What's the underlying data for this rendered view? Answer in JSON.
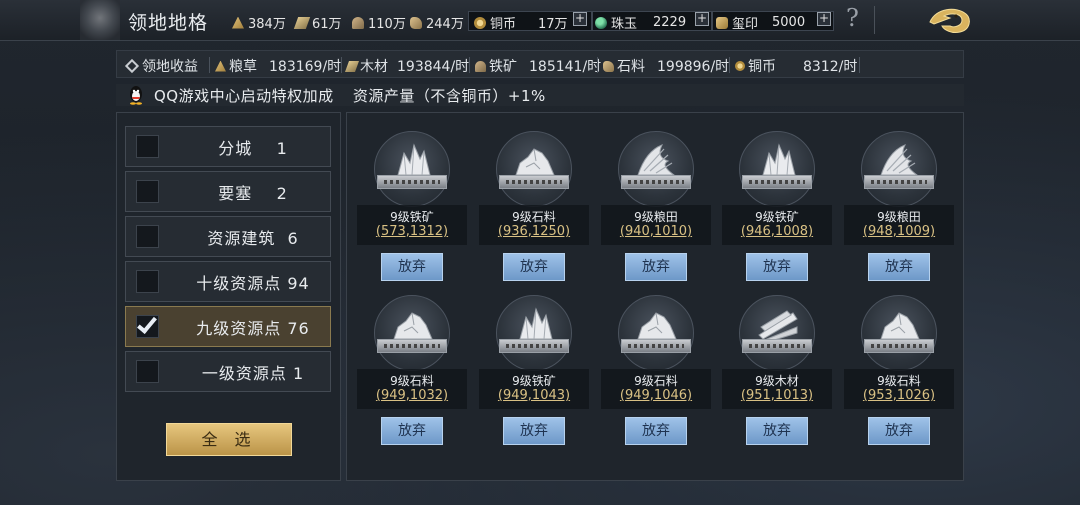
{
  "header": {
    "title": "领地地格",
    "resources": [
      {
        "icon": "grain-icon",
        "value": "384万"
      },
      {
        "icon": "wood-icon",
        "value": "61万"
      },
      {
        "icon": "iron-icon",
        "value": "110万"
      },
      {
        "icon": "stone-icon",
        "value": "244万"
      }
    ],
    "currencies": [
      {
        "icon": "copper-coin-icon",
        "label": "铜币",
        "value": "17万"
      },
      {
        "icon": "jade-icon",
        "label": "珠玉",
        "value": "2229"
      },
      {
        "icon": "seal-icon",
        "label": "玺印",
        "value": "5000"
      }
    ],
    "plus": "+",
    "help": "?"
  },
  "income": {
    "title": "领地收益",
    "items": [
      {
        "icon": "grain-icon",
        "label": "粮草",
        "value": "183169/时"
      },
      {
        "icon": "wood-icon",
        "label": "木材",
        "value": "193844/时"
      },
      {
        "icon": "iron-icon",
        "label": "铁矿",
        "value": "185141/时"
      },
      {
        "icon": "stone-icon",
        "label": "石料",
        "value": "199896/时"
      },
      {
        "icon": "copper-coin-icon",
        "label": "铜币",
        "value": "8312/时"
      }
    ]
  },
  "qq_bonus": {
    "text": "QQ游戏中心启动特权加成",
    "effect": "资源产量（不含铜币）+1%"
  },
  "filters": [
    {
      "label": "分城",
      "count": "1",
      "checked": false
    },
    {
      "label": "要塞",
      "count": "2",
      "checked": false
    },
    {
      "label": "资源建筑",
      "count": "6",
      "checked": false
    },
    {
      "label": "十级资源点",
      "count": "94",
      "checked": false
    },
    {
      "label": "九级资源点",
      "count": "76",
      "checked": true
    },
    {
      "label": "一级资源点",
      "count": "1",
      "checked": false
    }
  ],
  "select_all": "全 选",
  "tiles": [
    {
      "name": "9级铁矿",
      "coord": "(573,1312)",
      "kind": "iron",
      "action": "放弃"
    },
    {
      "name": "9级石料",
      "coord": "(936,1250)",
      "kind": "stone",
      "action": "放弃"
    },
    {
      "name": "9级粮田",
      "coord": "(940,1010)",
      "kind": "grain",
      "action": "放弃"
    },
    {
      "name": "9级铁矿",
      "coord": "(946,1008)",
      "kind": "iron",
      "action": "放弃"
    },
    {
      "name": "9级粮田",
      "coord": "(948,1009)",
      "kind": "grain",
      "action": "放弃"
    },
    {
      "name": "9级石料",
      "coord": "(949,1032)",
      "kind": "stone",
      "action": "放弃"
    },
    {
      "name": "9级铁矿",
      "coord": "(949,1043)",
      "kind": "iron",
      "action": "放弃"
    },
    {
      "name": "9级石料",
      "coord": "(949,1046)",
      "kind": "stone",
      "action": "放弃"
    },
    {
      "name": "9级木材",
      "coord": "(951,1013)",
      "kind": "wood",
      "action": "放弃"
    },
    {
      "name": "9级石料",
      "coord": "(953,1026)",
      "kind": "stone",
      "action": "放弃"
    }
  ],
  "colors": {
    "accent_gold": "#d9c184",
    "button_blue": "#8ab0dc",
    "active_filter": "#4a4130"
  }
}
